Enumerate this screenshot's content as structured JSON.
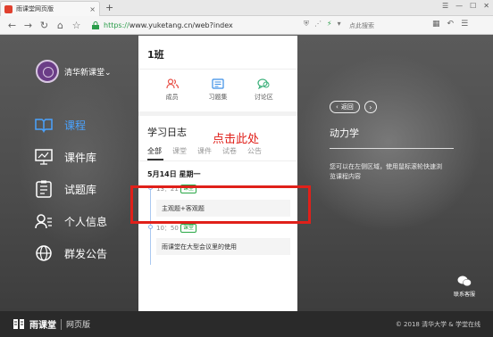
{
  "browser": {
    "tab_title": "雨课堂网页版",
    "new_tab": "+",
    "url_scheme": "https://",
    "url_rest": "www.yuketang.cn/web?index",
    "search_placeholder": "点此搜索"
  },
  "sidebar": {
    "brand": "清华新课堂",
    "items": [
      {
        "label": "课程",
        "icon": "book-icon"
      },
      {
        "label": "课件库",
        "icon": "presentation-icon"
      },
      {
        "label": "试题库",
        "icon": "checklist-icon"
      },
      {
        "label": "个人信息",
        "icon": "user-card-icon"
      },
      {
        "label": "群发公告",
        "icon": "globe-icon"
      }
    ]
  },
  "card": {
    "class_title": "1班",
    "tiles": [
      {
        "label": "成员",
        "icon": "members-icon",
        "color": "#e8534a"
      },
      {
        "label": "习题集",
        "icon": "exercise-icon",
        "color": "#3a8ee6"
      },
      {
        "label": "讨论区",
        "icon": "discussion-icon",
        "color": "#3bb07a"
      }
    ],
    "log_title": "学习日志",
    "filters": [
      "全部",
      "课堂",
      "课件",
      "试卷",
      "公告"
    ],
    "date": "5月14日   星期一",
    "entries": [
      {
        "time": "13：21",
        "tag": "课堂",
        "text": "主观题+客观题"
      },
      {
        "time": "10：50",
        "tag": "课堂",
        "text": "雨课堂在大型会议里的使用"
      }
    ]
  },
  "annotation": {
    "text": "点击此处",
    "color": "#e0201a"
  },
  "right_panel": {
    "back_label": "返回",
    "course_name": "动力学",
    "hint": "您可以在左侧区域，使用鼠标滚轮快速浏览课程内容",
    "support_label": "联系客服"
  },
  "footer": {
    "logo_text": "雨课堂",
    "logo_sub": "网页版",
    "copyright": "© 2018 清华大学 & 学堂在线"
  }
}
